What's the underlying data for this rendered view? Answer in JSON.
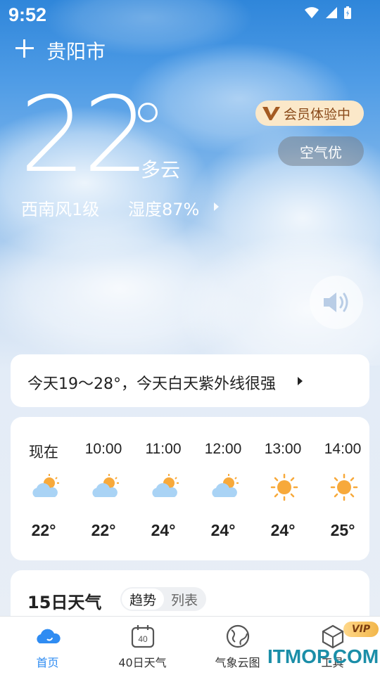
{
  "status_bar": {
    "time": "9:52"
  },
  "header": {
    "city": "贵阳市"
  },
  "current": {
    "temperature": "22",
    "condition": "多云",
    "wind": "西南风1级",
    "humidity": "湿度87%",
    "vip_label": "会员体验中",
    "aqi_label": "空气优"
  },
  "today_summary": "今天19～28°，今天白天紫外线很强",
  "hourly": [
    {
      "time": "现在",
      "icon": "partly-cloudy-icon",
      "temp": "22°"
    },
    {
      "time": "10:00",
      "icon": "partly-cloudy-icon",
      "temp": "22°"
    },
    {
      "time": "11:00",
      "icon": "partly-cloudy-icon",
      "temp": "24°"
    },
    {
      "time": "12:00",
      "icon": "partly-cloudy-icon",
      "temp": "24°"
    },
    {
      "time": "13:00",
      "icon": "sunny-icon",
      "temp": "24°"
    },
    {
      "time": "14:00",
      "icon": "sunny-icon",
      "temp": "25°"
    }
  ],
  "daily": {
    "title": "15日天气",
    "tab_trend": "趋势",
    "tab_list": "列表"
  },
  "bottom_nav": [
    {
      "label": "首页",
      "icon": "home-cloud-icon",
      "active": true
    },
    {
      "label": "40日天气",
      "icon": "calendar-40-icon",
      "active": false
    },
    {
      "label": "气象云图",
      "icon": "globe-icon",
      "active": false
    },
    {
      "label": "工具",
      "icon": "cube-icon",
      "active": false
    }
  ],
  "vip_tag": "VIP",
  "watermark": "ITMOP.COM",
  "colors": {
    "accent": "#2f8cf2",
    "vip_bg": "#fbe8c9",
    "vip_text": "#8a4a1a",
    "sun": "#f7a93b"
  }
}
